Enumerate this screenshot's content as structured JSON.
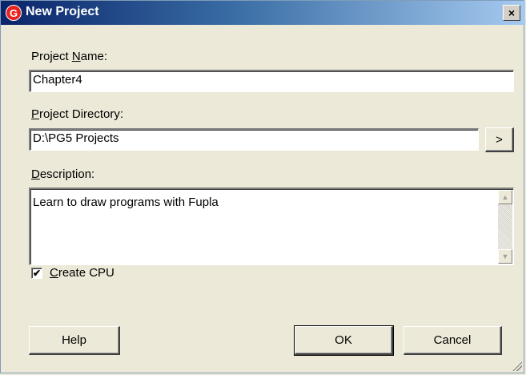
{
  "window": {
    "title": "New Project",
    "icon_glyph": "G",
    "close_glyph": "×"
  },
  "project_name": {
    "label_before": "Project ",
    "label_accel": "N",
    "label_after": "ame:",
    "value": "Chapter4"
  },
  "project_directory": {
    "label_accel": "P",
    "label_after": "roject Directory:",
    "value": "D:\\PG5 Projects",
    "browse_label": ">"
  },
  "description": {
    "label_accel": "D",
    "label_after": "escription:",
    "value": "Learn to draw programs with Fupla",
    "scroll_up_glyph": "▲",
    "scroll_down_glyph": "▼"
  },
  "create_cpu": {
    "checked": true,
    "check_glyph": "✔",
    "label_accel": "C",
    "label_after": "reate CPU"
  },
  "buttons": {
    "help": "Help",
    "ok": "OK",
    "cancel": "Cancel"
  },
  "icons": {
    "app": "pg5-app-icon",
    "close": "close-icon",
    "check": "check-icon",
    "resize": "resize-grip-icon"
  }
}
